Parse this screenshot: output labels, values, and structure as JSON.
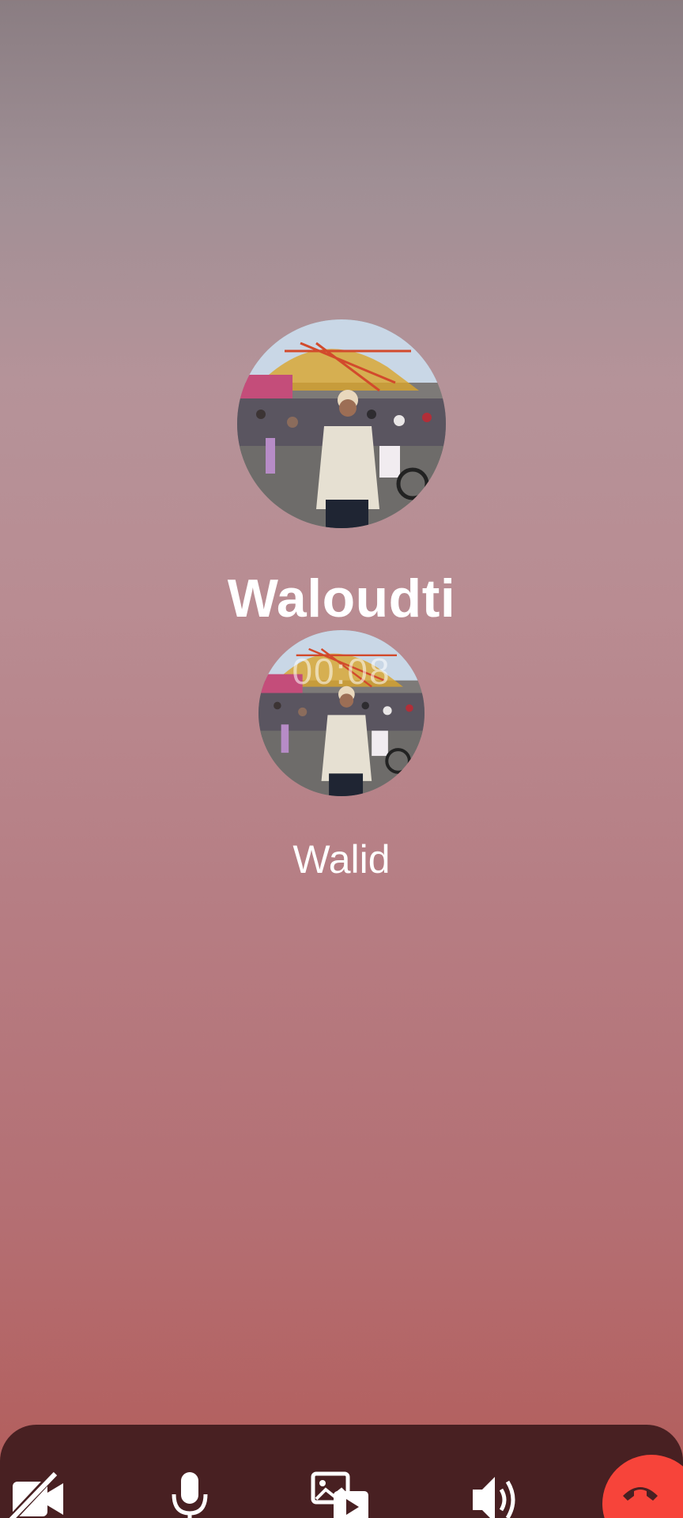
{
  "call": {
    "caller_name": "Waloudti",
    "timer": "00:08",
    "participant_name": "Walid"
  },
  "icons": {
    "avatar_main": "profile-photo",
    "avatar_secondary": "profile-photo",
    "video": "video-off-icon",
    "mic": "microphone-icon",
    "media": "media-share-icon",
    "speaker": "speaker-icon",
    "end_call": "phone-hangup-icon"
  },
  "colors": {
    "control_bar": "#482022",
    "end_call": "#f7443a",
    "text": "#ffffff"
  }
}
